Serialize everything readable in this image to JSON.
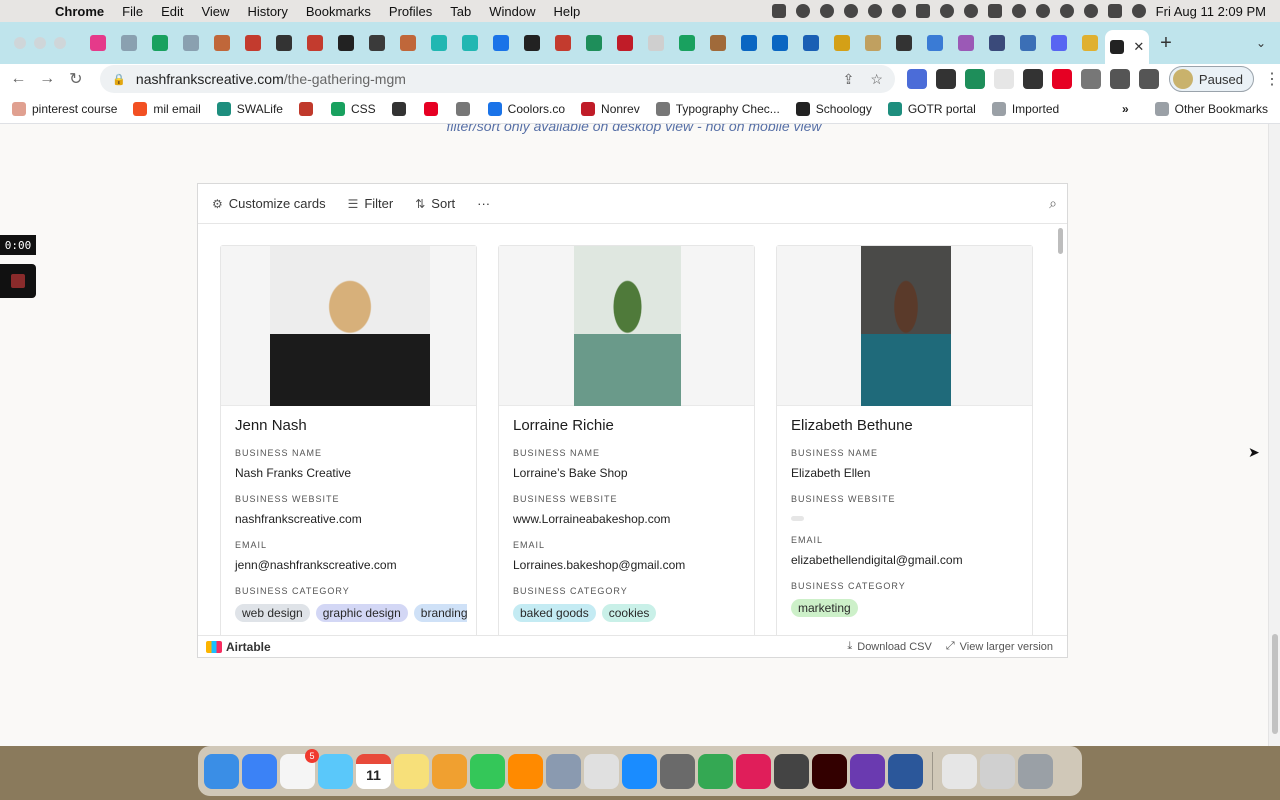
{
  "menubar": {
    "app": "Chrome",
    "items": [
      "File",
      "Edit",
      "View",
      "History",
      "Bookmarks",
      "Profiles",
      "Tab",
      "Window",
      "Help"
    ],
    "clock": "Fri Aug 11  2:09 PM"
  },
  "tabs": {
    "favicon_colors": [
      "#e53a8a",
      "#8aa0b0",
      "#19a15f",
      "#8aa0b0",
      "#c0673a",
      "#c33b2e",
      "#333333",
      "#c33b2e",
      "#222222",
      "#3a3a3a",
      "#c0673a",
      "#21b7b2",
      "#21b7b2",
      "#1a73e8",
      "#222222",
      "#c33b2e",
      "#1e8e5a",
      "#c01c28",
      "#cfcfcf",
      "#19a15f",
      "#a06a3a",
      "#0a66c2",
      "#0a66c2",
      "#1a5fb4",
      "#d4a017",
      "#c0a060",
      "#333333",
      "#3a7bd5",
      "#9b59b6",
      "#3a4a7a",
      "#3b6fb6",
      "#5865f2",
      "#e0b030"
    ],
    "active_close": "✕",
    "new_tab": "+"
  },
  "toolbar": {
    "url_host": "nashfrankscreative.com",
    "url_path": "/the-gathering-mgm",
    "profile_label": "Paused",
    "extension_colors": [
      "#4b6cd8",
      "#333333",
      "#1e8e5a",
      "#e6e6e6",
      "#333333",
      "#e60023",
      "#777777",
      "#555555",
      "#555555"
    ]
  },
  "bookmarks": {
    "items": [
      {
        "label": "pinterest course",
        "color": "#e0a090"
      },
      {
        "label": "mil email",
        "color": "#f25022"
      },
      {
        "label": "SWALife",
        "color": "#1e8e7e"
      },
      {
        "label": "",
        "color": "#c0392b"
      },
      {
        "label": "CSS",
        "color": "#19a15f"
      },
      {
        "label": "",
        "color": "#333333"
      },
      {
        "label": "",
        "color": "#e60023"
      },
      {
        "label": "",
        "color": "#777777"
      },
      {
        "label": "Coolors.co",
        "color": "#1a73e8"
      },
      {
        "label": "Nonrev",
        "color": "#c01c28"
      },
      {
        "label": "Typography Chec...",
        "color": "#777777"
      },
      {
        "label": "Schoology",
        "color": "#222222"
      },
      {
        "label": "GOTR portal",
        "color": "#1e8e7e"
      },
      {
        "label": "Imported",
        "color": "#9aa0a6"
      }
    ],
    "overflow": "»",
    "other": "Other Bookmarks"
  },
  "page": {
    "top_note": "filter/sort only available on desktop view - not on mobile view"
  },
  "recorder": {
    "time": "0:00"
  },
  "airtable": {
    "toolbar": {
      "customize": "Customize cards",
      "filter": "Filter",
      "sort": "Sort",
      "more": "···"
    },
    "cards": [
      {
        "name": "Jenn Nash",
        "fields": [
          {
            "label": "BUSINESS NAME",
            "value": "Nash Franks Creative"
          },
          {
            "label": "BUSINESS WEBSITE",
            "value": "nashfrankscreative.com"
          },
          {
            "label": "EMAIL",
            "value": "jenn@nashfrankscreative.com"
          }
        ],
        "category_label": "BUSINESS CATEGORY",
        "tags": [
          {
            "label": "web design",
            "color": "#dfe3e8"
          },
          {
            "label": "graphic design",
            "color": "#d3d7f5"
          },
          {
            "label": "branding",
            "color": "#cfe1f7"
          }
        ],
        "photo_colors": [
          "#ededed",
          "#1b1b1b",
          "#d7b07a"
        ]
      },
      {
        "name": "Lorraine Richie",
        "fields": [
          {
            "label": "BUSINESS NAME",
            "value": "Lorraine’s Bake Shop"
          },
          {
            "label": "BUSINESS WEBSITE",
            "value": "www.Lorraineabakeshop.com"
          },
          {
            "label": "EMAIL",
            "value": "Lorraines.bakeshop@gmail.com"
          }
        ],
        "category_label": "BUSINESS CATEGORY",
        "tags": [
          {
            "label": "baked goods",
            "color": "#c4ebf3"
          },
          {
            "label": "cookies",
            "color": "#c9f0e8"
          }
        ],
        "photo_colors": [
          "#dfe7e0",
          "#6a9a8a",
          "#4f7a3a"
        ]
      },
      {
        "name": "Elizabeth Bethune",
        "fields": [
          {
            "label": "BUSINESS NAME",
            "value": "Elizabeth Ellen"
          },
          {
            "label": "BUSINESS WEBSITE",
            "value": ""
          },
          {
            "label": "EMAIL",
            "value": "elizabethellendigital@gmail.com"
          }
        ],
        "category_label": "BUSINESS CATEGORY",
        "tags": [
          {
            "label": "marketing",
            "color": "#cdf0c9"
          }
        ],
        "photo_colors": [
          "#4a4a48",
          "#1f6a7a",
          "#5a3a2a"
        ]
      }
    ],
    "footer": {
      "brand": "Airtable",
      "download": "Download CSV",
      "larger": "View larger version"
    }
  },
  "dock": {
    "calendar_day": "11",
    "messages_badge": "5",
    "app_colors": [
      "#3a8ee6",
      "#3b82f6",
      "#f5f5f5",
      "#5ac8fa",
      "#e84a3a",
      "#f7e07a",
      "#f0a030",
      "#34c759",
      "#ff8a00",
      "#8a9ab0",
      "#e0e0e0",
      "#1a8cff",
      "#6a6a6a",
      "#34a853",
      "#e01e5a",
      "#444444",
      "#330000",
      "#6a3ab0",
      "#2b579a",
      "#e6e6e6",
      "#d0d0d0",
      "#9aa0a6"
    ]
  }
}
